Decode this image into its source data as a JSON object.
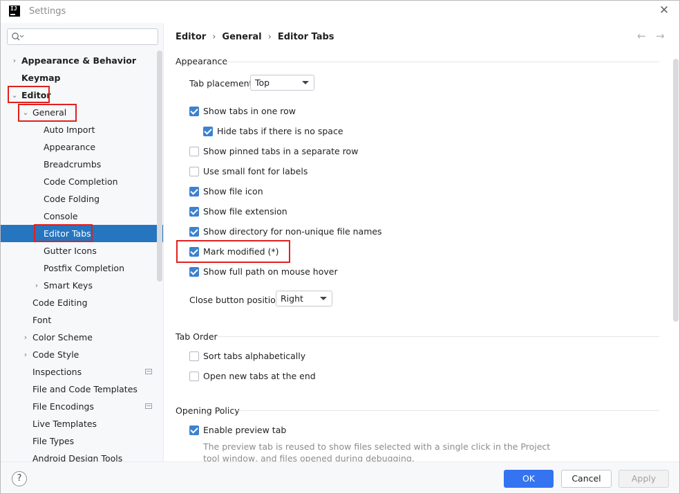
{
  "window": {
    "title": "Settings",
    "app_icon_text": "IJ"
  },
  "search": {
    "placeholder": ""
  },
  "sidebar": {
    "items": [
      {
        "label": "Appearance & Behavior"
      },
      {
        "label": "Keymap"
      },
      {
        "label": "Editor"
      },
      {
        "label": "General"
      },
      {
        "label": "Auto Import"
      },
      {
        "label": "Appearance"
      },
      {
        "label": "Breadcrumbs"
      },
      {
        "label": "Code Completion"
      },
      {
        "label": "Code Folding"
      },
      {
        "label": "Console"
      },
      {
        "label": "Editor Tabs"
      },
      {
        "label": "Gutter Icons"
      },
      {
        "label": "Postfix Completion"
      },
      {
        "label": "Smart Keys"
      },
      {
        "label": "Code Editing"
      },
      {
        "label": "Font"
      },
      {
        "label": "Color Scheme"
      },
      {
        "label": "Code Style"
      },
      {
        "label": "Inspections"
      },
      {
        "label": "File and Code Templates"
      },
      {
        "label": "File Encodings"
      },
      {
        "label": "Live Templates"
      },
      {
        "label": "File Types"
      },
      {
        "label": "Android Design Tools"
      }
    ],
    "selected": "Editor Tabs"
  },
  "breadcrumb": {
    "items": [
      "Editor",
      "General",
      "Editor Tabs"
    ]
  },
  "appearance": {
    "title": "Appearance",
    "tab_placement_label": "Tab placement:",
    "tab_placement_value": "Top",
    "checkboxes": [
      {
        "label": "Show tabs in one row",
        "checked": true
      },
      {
        "label": "Hide tabs if there is no space",
        "checked": true
      },
      {
        "label": "Show pinned tabs in a separate row",
        "checked": false
      },
      {
        "label": "Use small font for labels",
        "checked": false
      },
      {
        "label": "Show file icon",
        "checked": true
      },
      {
        "label": "Show file extension",
        "checked": true
      },
      {
        "label": "Show directory for non-unique file names",
        "checked": true
      },
      {
        "label": "Mark modified (*)",
        "checked": true
      },
      {
        "label": "Show full path on mouse hover",
        "checked": true
      }
    ],
    "close_button_label": "Close button position:",
    "close_button_value": "Right"
  },
  "tab_order": {
    "title": "Tab Order",
    "checkboxes": [
      {
        "label": "Sort tabs alphabetically",
        "checked": false
      },
      {
        "label": "Open new tabs at the end",
        "checked": false
      }
    ]
  },
  "opening_policy": {
    "title": "Opening Policy",
    "checkboxes": [
      {
        "label": "Enable preview tab",
        "checked": true
      }
    ],
    "description": "The preview tab is reused to show files selected with a single click in the Project tool window, and files opened during debugging."
  },
  "footer": {
    "help": "?",
    "ok": "OK",
    "cancel": "Cancel",
    "apply": "Apply"
  },
  "colors": {
    "selection": "#2675bf",
    "accent": "#3574f0",
    "highlight_box": "#e0201f"
  }
}
